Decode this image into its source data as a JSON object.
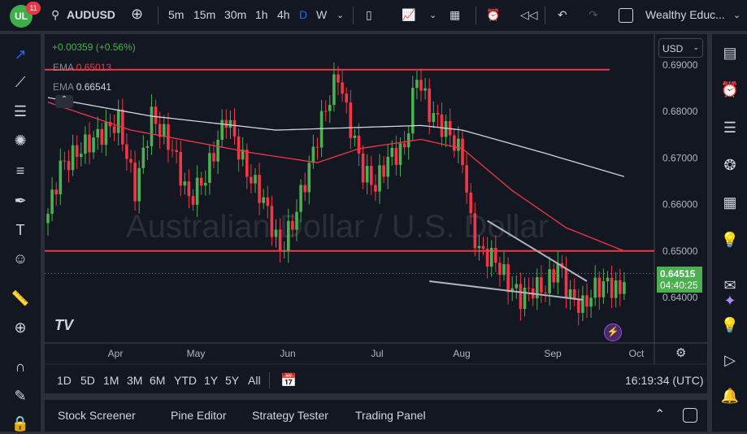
{
  "header": {
    "badge_count": "11",
    "symbol": "AUDUSD",
    "timeframes": [
      "5m",
      "15m",
      "30m",
      "1h",
      "4h",
      "D",
      "W"
    ],
    "active_timeframe": "D",
    "account": "Wealthy Educ..."
  },
  "legend": {
    "change": "+0.00359 (+0.56%)",
    "ema1_label": "EMA",
    "ema1_value": "0.65013",
    "ema2_label": "EMA",
    "ema2_value": "0.66541"
  },
  "currency": "USD",
  "price_badge": {
    "price": "0.64515",
    "countdown": "04:40:25"
  },
  "ranges": [
    "1D",
    "5D",
    "1M",
    "3M",
    "6M",
    "YTD",
    "1Y",
    "5Y",
    "All"
  ],
  "clock": "16:19:34 (UTC)",
  "bottom_tabs": [
    "Stock Screener",
    "Pine Editor",
    "Strategy Tester",
    "Trading Panel"
  ],
  "watermark": "Australian Dollar / U.S. Dollar",
  "colors": {
    "up": "#4caf50",
    "down": "#f23645",
    "ema50": "#f23645",
    "ema200": "#d1d4dc",
    "accent": "#2962ff"
  },
  "chart_data": {
    "type": "candlestick",
    "ylim": [
      0.635,
      0.692
    ],
    "y_ticks": [
      "0.69000",
      "0.68000",
      "0.67000",
      "0.66000",
      "0.65000",
      "0.64000"
    ],
    "x_ticks": [
      "Apr",
      "May",
      "Jun",
      "Jul",
      "Aug",
      "Sep",
      "Oct"
    ],
    "close_path": [
      [
        0,
        0.658
      ],
      [
        3,
        0.668
      ],
      [
        8,
        0.672
      ],
      [
        17,
        0.678
      ],
      [
        21,
        0.663
      ],
      [
        25,
        0.679
      ],
      [
        30,
        0.672
      ],
      [
        34,
        0.661
      ],
      [
        38,
        0.666
      ],
      [
        43,
        0.679
      ],
      [
        48,
        0.667
      ],
      [
        52,
        0.661
      ],
      [
        56,
        0.65
      ],
      [
        59,
        0.656
      ],
      [
        63,
        0.668
      ],
      [
        66,
        0.678
      ],
      [
        70,
        0.688
      ],
      [
        72,
        0.68
      ],
      [
        76,
        0.667
      ],
      [
        79,
        0.664
      ],
      [
        82,
        0.67
      ],
      [
        86,
        0.672
      ],
      [
        89,
        0.688
      ],
      [
        92,
        0.68
      ],
      [
        97,
        0.675
      ],
      [
        100,
        0.67
      ],
      [
        102,
        0.656
      ],
      [
        104,
        0.65
      ],
      [
        108,
        0.648
      ],
      [
        111,
        0.643
      ],
      [
        114,
        0.64
      ],
      [
        117,
        0.642
      ],
      [
        120,
        0.642
      ],
      [
        123,
        0.647
      ],
      [
        126,
        0.64
      ],
      [
        129,
        0.638
      ],
      [
        132,
        0.642
      ],
      [
        135,
        0.643
      ],
      [
        138,
        0.641
      ],
      [
        139,
        0.645
      ]
    ],
    "ema_fast": [
      [
        0,
        0.682
      ],
      [
        20,
        0.676
      ],
      [
        50,
        0.671
      ],
      [
        65,
        0.669
      ],
      [
        75,
        0.672
      ],
      [
        90,
        0.674
      ],
      [
        100,
        0.672
      ],
      [
        112,
        0.663
      ],
      [
        125,
        0.655
      ],
      [
        139,
        0.65
      ]
    ],
    "ema_slow": [
      [
        0,
        0.683
      ],
      [
        25,
        0.679
      ],
      [
        55,
        0.676
      ],
      [
        90,
        0.677
      ],
      [
        100,
        0.676
      ],
      [
        120,
        0.671
      ],
      [
        139,
        0.666
      ]
    ],
    "hlines": [
      0.689,
      0.65
    ],
    "trendlines": [
      [
        [
          106,
          0.6565
        ],
        [
          130,
          0.6435
        ]
      ],
      [
        [
          92,
          0.6435
        ],
        [
          129,
          0.6395
        ]
      ]
    ],
    "last_price": 0.64515
  }
}
